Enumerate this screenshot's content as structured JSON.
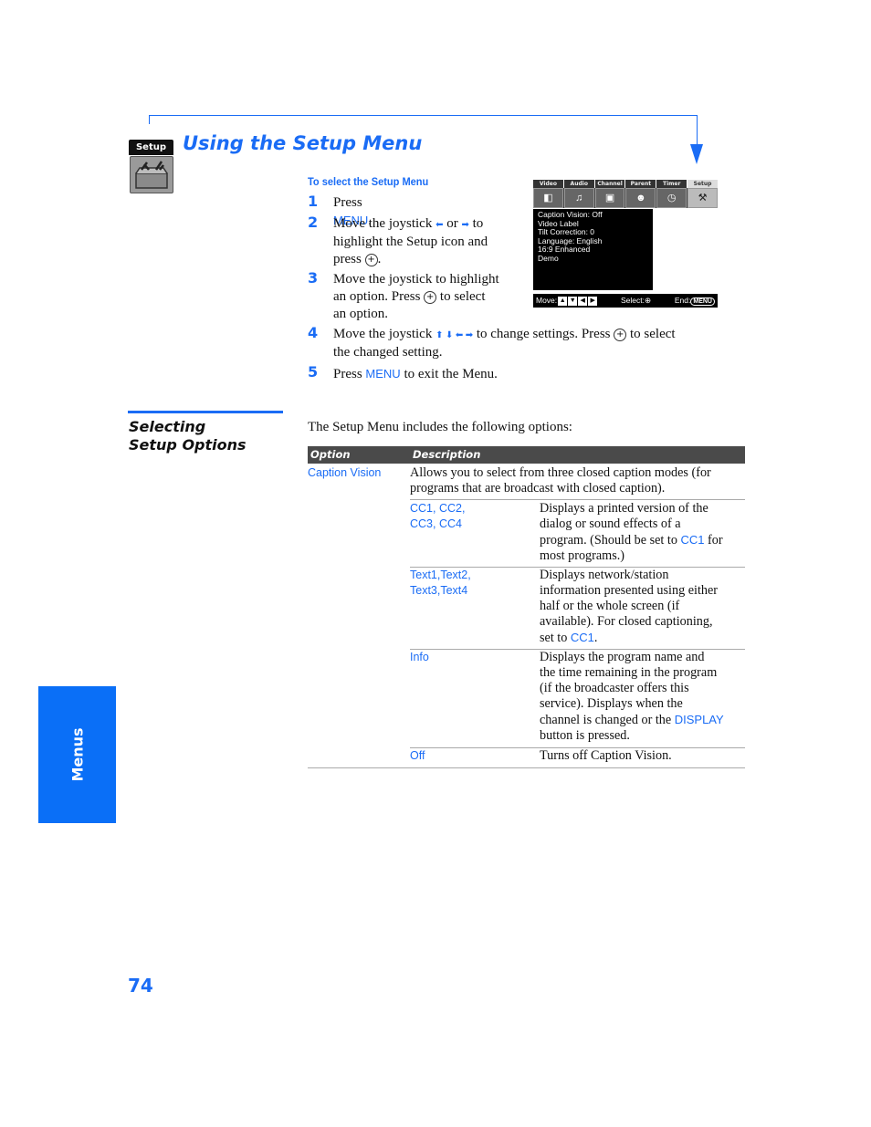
{
  "header": {
    "icon_label": "Setup",
    "title": "Using the Setup Menu"
  },
  "procedure": {
    "heading": "To select the Setup Menu",
    "steps": [
      {
        "num": "1",
        "parts": {
          "a": "Press ",
          "menu": "MENU",
          "b": "."
        }
      },
      {
        "num": "2",
        "parts": {
          "a": "Move the joystick ",
          "left": "⬅",
          "or": " or ",
          "right": "➡",
          "b": " to",
          "line2": "highlight the Setup icon and",
          "line3a": "press ",
          "btn": "⊕",
          "line3b": "."
        }
      },
      {
        "num": "3",
        "parts": {
          "line1": "Move the joystick to highlight",
          "line2a": "an option. Press ",
          "btn": "⊕",
          "line2b": " to select",
          "line3": "an option."
        }
      },
      {
        "num": "4",
        "parts": {
          "a": "Move the joystick ",
          "arrows": "⬆ ⬇ ⬅ ➡",
          "b": " to change settings. Press ",
          "btn": "⊕",
          "c": " to select",
          "line2": "the changed setting."
        }
      },
      {
        "num": "5",
        "parts": {
          "a": "Press ",
          "menu": "MENU",
          "b": " to exit the Menu."
        }
      }
    ]
  },
  "tv_menu": {
    "tabs": [
      "Video",
      "Audio",
      "Channel",
      "Parent",
      "Timer",
      "Setup"
    ],
    "active_tab": "Setup",
    "tab_icons": [
      "video-icon",
      "audio-icon",
      "channel-icon",
      "parent-icon",
      "timer-icon",
      "setup-icon"
    ],
    "items": [
      "Caption Vision: Off",
      "Video Label",
      "Tilt Correction: 0",
      "Language: English",
      "16:9 Enhanced",
      "Demo"
    ],
    "footer": {
      "move": "Move:",
      "select": "Select:",
      "end": "End:",
      "menu": "MENU"
    }
  },
  "section": {
    "title_line1": "Selecting",
    "title_line2": "Setup Options",
    "intro": "The Setup Menu includes the following options:"
  },
  "table": {
    "headers": {
      "option": "Option",
      "description": "Description"
    },
    "option": "Caption Vision",
    "option_desc_line1": "Allows you to select from three closed caption modes (for",
    "option_desc_line2": "programs that are broadcast with closed caption).",
    "sub_rows": [
      {
        "name_line1": "CC1, CC2,",
        "name_line2": "CC3, CC4",
        "desc": [
          "Displays a printed version of the",
          "dialog or sound effects of a",
          "program. (Should be set to ",
          "CC1",
          " for",
          "most programs.)"
        ]
      },
      {
        "name_line1": "Text1,Text2,",
        "name_line2": "Text3,Text4",
        "desc": [
          "Displays network/station",
          "information presented using either",
          "half or the whole screen (if",
          "available). For closed captioning,",
          "set to ",
          "CC1",
          "."
        ]
      },
      {
        "name_line1": "Info",
        "name_line2": "",
        "desc": [
          "Displays the program name and",
          "the time remaining in the program",
          "(if the broadcaster offers this",
          "service). Displays when the",
          "channel is changed or the ",
          "DISPLAY",
          "button is pressed."
        ]
      },
      {
        "name_line1": "Off",
        "name_line2": "",
        "desc": [
          "Turns off Caption Vision."
        ]
      }
    ]
  },
  "side_tab": {
    "label": "Menus"
  },
  "page_number": "74",
  "colors": {
    "accent": "#1a6cf5",
    "side_tab": "#0a6ff7",
    "table_header": "#4a4a4a"
  }
}
